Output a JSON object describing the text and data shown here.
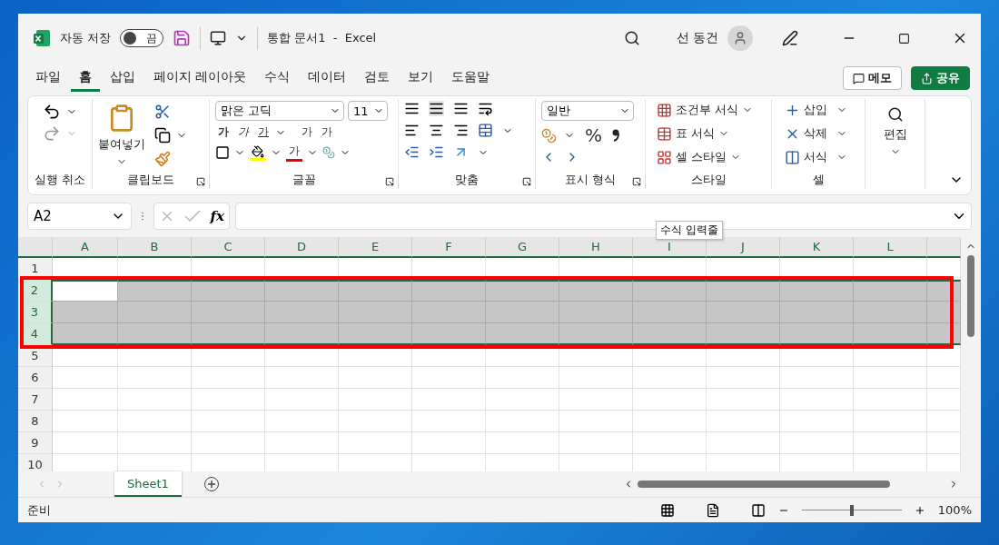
{
  "title_bar": {
    "autosave_label": "자동 저장",
    "autosave_toggle": {
      "on": false,
      "label": "끔"
    },
    "document_title": "통합 문서1  -  Excel",
    "user_name": "선 동건"
  },
  "menu_tabs": [
    {
      "label": "파일",
      "selected": false
    },
    {
      "label": "홈",
      "selected": true
    },
    {
      "label": "삽입",
      "selected": false
    },
    {
      "label": "페이지 레이아웃",
      "selected": false
    },
    {
      "label": "수식",
      "selected": false
    },
    {
      "label": "데이터",
      "selected": false
    },
    {
      "label": "검토",
      "selected": false
    },
    {
      "label": "보기",
      "selected": false
    },
    {
      "label": "도움말",
      "selected": false
    }
  ],
  "memo_button": "메모",
  "share_button": "공유",
  "ribbon": {
    "undo": {
      "label": "실행 취소"
    },
    "clipboard": {
      "label": "클립보드",
      "paste": "붙여넣기"
    },
    "font": {
      "label": "글꼴",
      "font_name": "맑은 고딕",
      "font_size": "11",
      "bold": "가",
      "italic": "가",
      "underline": "가",
      "grow": "가",
      "shrink": "가",
      "font_color": "가"
    },
    "alignment": {
      "label": "맞춤"
    },
    "number": {
      "label": "표시 형식",
      "format": "일반",
      "percent": "%"
    },
    "styles": {
      "label": "스타일",
      "items": [
        "조건부 서식",
        "표 서식",
        "셀 스타일"
      ]
    },
    "cells": {
      "label": "셀",
      "items": [
        "삽입",
        "삭제",
        "서식"
      ]
    },
    "editing": {
      "label": "편집"
    }
  },
  "formula_bar": {
    "name_box": "A2",
    "function_button": "fx",
    "tooltip": "수식 입력줄"
  },
  "sheet": {
    "columns": [
      "A",
      "B",
      "C",
      "D",
      "E",
      "F",
      "G",
      "H",
      "I",
      "J",
      "K",
      "L"
    ],
    "rows": [
      {
        "label": "1",
        "selected": false,
        "active": false
      },
      {
        "label": "2",
        "selected": true,
        "active": true
      },
      {
        "label": "3",
        "selected": true,
        "active": false
      },
      {
        "label": "4",
        "selected": true,
        "active": false
      },
      {
        "label": "5",
        "selected": false,
        "active": false
      },
      {
        "label": "6",
        "selected": false,
        "active": false
      },
      {
        "label": "7",
        "selected": false,
        "active": false
      },
      {
        "label": "8",
        "selected": false,
        "active": false
      },
      {
        "label": "9",
        "selected": false,
        "active": false
      },
      {
        "label": "10",
        "selected": false,
        "active": false
      }
    ]
  },
  "annotation": {
    "kind": "frame"
  },
  "sheet_tabs": [
    {
      "label": "Sheet1",
      "selected": true
    }
  ],
  "status_bar": {
    "status": "준비",
    "zoom": "100%",
    "zoom_slider": {
      "level": 0.5
    }
  }
}
